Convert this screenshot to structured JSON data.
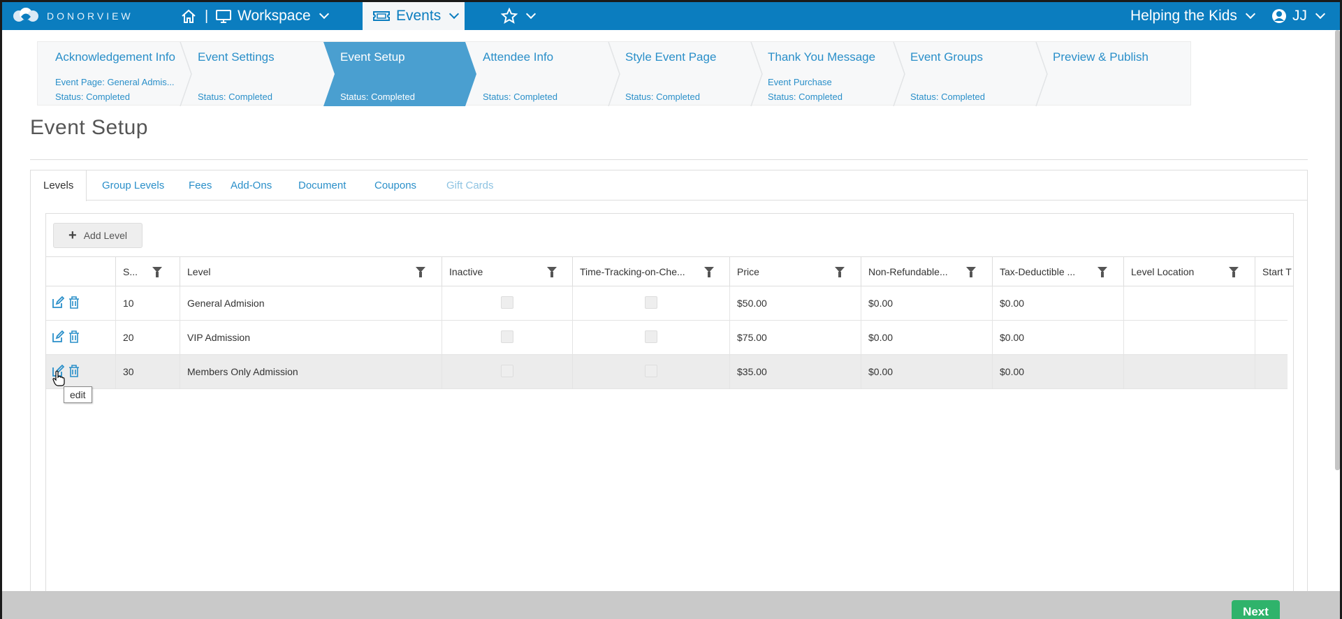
{
  "app": {
    "logo_text": "DONORVIEW",
    "nav": {
      "workspace_label": "Workspace",
      "events_label": "Events",
      "org_label": "Helping the Kids",
      "user_label": "JJ",
      "separator": "|"
    }
  },
  "wizard": {
    "steps": [
      {
        "name": "Acknowledgement Info",
        "desc": "Event Page: General Admis...",
        "status": "Status: Completed"
      },
      {
        "name": "Event Settings",
        "desc": "",
        "status": "Status: Completed"
      },
      {
        "name": "Event Setup",
        "desc": "",
        "status": "Status: Completed"
      },
      {
        "name": "Attendee Info",
        "desc": "",
        "status": "Status: Completed"
      },
      {
        "name": "Style Event Page",
        "desc": "",
        "status": "Status: Completed"
      },
      {
        "name": "Thank You Message",
        "desc": "Event Purchase",
        "status": "Status: Completed"
      },
      {
        "name": "Event Groups",
        "desc": "",
        "status": "Status: Completed"
      },
      {
        "name": "Preview & Publish",
        "desc": "",
        "status": ""
      }
    ],
    "active_index": 2,
    "active_color": "#4a9fd0"
  },
  "page": {
    "title": "Event Setup"
  },
  "tabs": [
    {
      "label": "Levels"
    },
    {
      "label": "Group Levels"
    },
    {
      "label": "Fees"
    },
    {
      "label": "Add-Ons"
    },
    {
      "label": "Document"
    },
    {
      "label": "Coupons"
    },
    {
      "label": "Gift Cards"
    }
  ],
  "grid": {
    "add_label": "Add Level",
    "columns": [
      "S...",
      "Level",
      "Inactive",
      "Time-Tracking-on-Che...",
      "Price",
      "Non-Refundable...",
      "Tax-Deductible ...",
      "Level Location",
      "Start T"
    ],
    "rows": [
      {
        "seq": "10",
        "level": "General Admision",
        "price": "$50.00",
        "nonref": "$0.00",
        "taxded": "$0.00"
      },
      {
        "seq": "20",
        "level": "VIP Admission",
        "price": "$75.00",
        "nonref": "$0.00",
        "taxded": "$0.00"
      },
      {
        "seq": "30",
        "level": "Members Only Admission",
        "price": "$35.00",
        "nonref": "$0.00",
        "taxded": "$0.00"
      }
    ],
    "tooltip": "edit"
  },
  "footer": {
    "next_label": "Next"
  },
  "colors": {
    "brand": "#0b7dbf",
    "link": "#2a8fc9",
    "next": "#2fb36b"
  }
}
